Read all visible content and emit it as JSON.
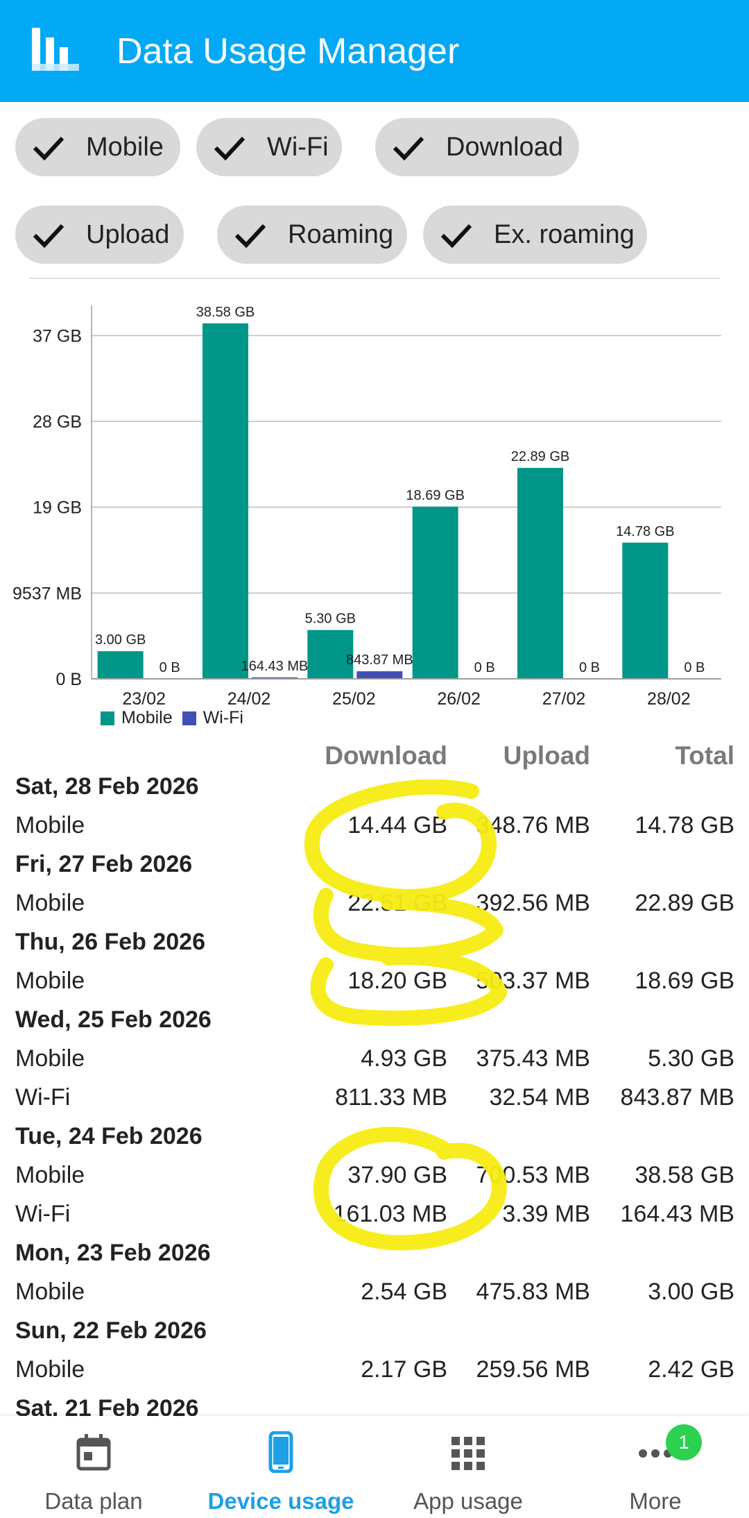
{
  "app": {
    "title": "Data Usage Manager"
  },
  "filters": [
    {
      "label": "Mobile",
      "checked": true
    },
    {
      "label": "Wi-Fi",
      "checked": true
    },
    {
      "label": "Download",
      "checked": true
    },
    {
      "label": "Upload",
      "checked": true
    },
    {
      "label": "Roaming",
      "checked": true
    },
    {
      "label": "Ex. roaming",
      "checked": true
    }
  ],
  "chart_data": {
    "type": "bar",
    "categories": [
      "23/02",
      "24/02",
      "25/02",
      "26/02",
      "27/02",
      "28/02"
    ],
    "series": [
      {
        "name": "Mobile",
        "color": "#009688",
        "values": [
          3.0,
          38.58,
          5.3,
          18.69,
          22.89,
          14.78
        ],
        "labels": [
          "3.00 GB",
          "38.58 GB",
          "5.30 GB",
          "18.69 GB",
          "22.89 GB",
          "14.78 GB"
        ]
      },
      {
        "name": "Wi-Fi",
        "color": "#3f51b5",
        "values": [
          0,
          0.16,
          0.82,
          0,
          0,
          0
        ],
        "labels": [
          "0 B",
          "164.43 MB",
          "843.87 MB",
          "0 B",
          "0 B",
          "0 B"
        ]
      }
    ],
    "yticks": [
      {
        "value": 0,
        "label": "0 B"
      },
      {
        "value": 9.31,
        "label": "9537 MB"
      },
      {
        "value": 18.63,
        "label": "19 GB"
      },
      {
        "value": 27.94,
        "label": "28 GB"
      },
      {
        "value": 37.25,
        "label": "37 GB"
      }
    ],
    "ylim": [
      0,
      40.3
    ],
    "unit": "GB",
    "grid": true,
    "legend": "bottom-left"
  },
  "table": {
    "headers": {
      "download": "Download",
      "upload": "Upload",
      "total": "Total"
    },
    "groups": [
      {
        "date": "Sat, 28 Feb 2026",
        "rows": [
          {
            "type": "Mobile",
            "download": "14.44 GB",
            "upload": "348.76 MB",
            "total": "14.78 GB"
          }
        ]
      },
      {
        "date": "Fri, 27 Feb 2026",
        "rows": [
          {
            "type": "Mobile",
            "download": "22.51 GB",
            "upload": "392.56 MB",
            "total": "22.89 GB"
          }
        ]
      },
      {
        "date": "Thu, 26 Feb 2026",
        "rows": [
          {
            "type": "Mobile",
            "download": "18.20 GB",
            "upload": "503.37 MB",
            "total": "18.69 GB"
          }
        ]
      },
      {
        "date": "Wed, 25 Feb 2026",
        "rows": [
          {
            "type": "Mobile",
            "download": "4.93 GB",
            "upload": "375.43 MB",
            "total": "5.30 GB"
          },
          {
            "type": "Wi-Fi",
            "download": "811.33 MB",
            "upload": "32.54 MB",
            "total": "843.87 MB"
          }
        ]
      },
      {
        "date": "Tue, 24 Feb 2026",
        "rows": [
          {
            "type": "Mobile",
            "download": "37.90 GB",
            "upload": "700.53 MB",
            "total": "38.58 GB"
          },
          {
            "type": "Wi-Fi",
            "download": "161.03 MB",
            "upload": "3.39 MB",
            "total": "164.43 MB"
          }
        ]
      },
      {
        "date": "Mon, 23 Feb 2026",
        "rows": [
          {
            "type": "Mobile",
            "download": "2.54 GB",
            "upload": "475.83 MB",
            "total": "3.00 GB"
          }
        ]
      },
      {
        "date": "Sun, 22 Feb 2026",
        "rows": [
          {
            "type": "Mobile",
            "download": "2.17 GB",
            "upload": "259.56 MB",
            "total": "2.42 GB"
          }
        ]
      },
      {
        "date": "Sat, 21 Feb 2026",
        "rows": []
      }
    ]
  },
  "nav": {
    "items": [
      {
        "label": "Data plan",
        "icon": "calendar-icon",
        "active": false
      },
      {
        "label": "Device usage",
        "icon": "phone-icon",
        "active": true
      },
      {
        "label": "App usage",
        "icon": "apps-grid-icon",
        "active": false
      },
      {
        "label": "More",
        "icon": "more-dots-icon",
        "active": false,
        "badge": "1"
      }
    ]
  },
  "colors": {
    "accent": "#03a9f4",
    "mobile": "#009688",
    "wifi": "#3f51b5",
    "highlighter": "#f7ec12",
    "badge": "#2bd14f"
  }
}
